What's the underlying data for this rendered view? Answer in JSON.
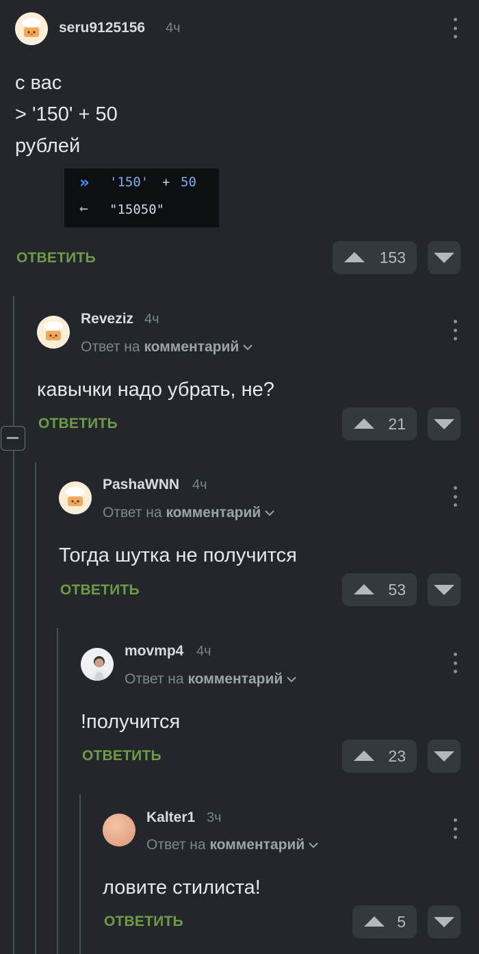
{
  "post": {
    "author": "seru9125156",
    "time": "4ч",
    "lines": [
      "с вас",
      "> '150' + 50",
      "рублей"
    ],
    "code": {
      "input_prefix": "»",
      "input_str": "'150'",
      "input_op": "+",
      "input_num": "50",
      "output_prefix": "←",
      "output": "\"15050\""
    },
    "reply_label": "ОТВЕТИТЬ",
    "votes": "153"
  },
  "collapse_symbol": "−",
  "replies": [
    {
      "author": "Reveziz",
      "time": "4ч",
      "reply_to_prefix": "Ответ на",
      "reply_to_link": "комментарий",
      "text": "кавычки надо убрать, не?",
      "reply_label": "ОТВЕТИТЬ",
      "votes": "21"
    },
    {
      "author": "PashaWNN",
      "time": "4ч",
      "reply_to_prefix": "Ответ на",
      "reply_to_link": "комментарий",
      "text": "Тогда шутка не получится",
      "reply_label": "ОТВЕТИТЬ",
      "votes": "53"
    },
    {
      "author": "movmp4",
      "time": "4ч",
      "reply_to_prefix": "Ответ на",
      "reply_to_link": "комментарий",
      "text": "!получится",
      "reply_label": "ОТВЕТИТЬ",
      "votes": "23"
    },
    {
      "author": "Kalter1",
      "time": "3ч",
      "reply_to_prefix": "Ответ на",
      "reply_to_link": "комментарий",
      "text": "ловите стилиста!",
      "reply_label": "ОТВЕТИТЬ",
      "votes": "5"
    }
  ],
  "colors": {
    "background": "#23272b",
    "accent_green": "#6e9b46",
    "button_bg": "#34393e",
    "thread_line": "#4a4f55"
  },
  "icons": {
    "default_avatar": "chef-hat-avatar-icon",
    "upvote": "triangle-up-icon",
    "downvote": "triangle-down-icon",
    "menu": "kebab-menu-icon",
    "chevron": "chevron-down-icon"
  }
}
